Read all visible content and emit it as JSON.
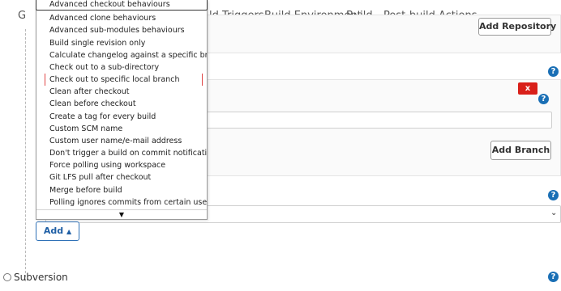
{
  "tabs": [
    {
      "label": "G"
    },
    {
      "label": "ld Triggers"
    },
    {
      "label": "Build Environment"
    },
    {
      "label": "Build"
    },
    {
      "label": "Post-build Actions"
    }
  ],
  "buttons": {
    "add_repository": "Add Repository",
    "add_branch": "Add Branch",
    "add": "Add",
    "delete_x": "x"
  },
  "help_glyph": "?",
  "dropdown": {
    "items": [
      "Advanced checkout behaviours",
      "Advanced clone behaviours",
      "Advanced sub-modules behaviours",
      "Build single revision only",
      "Calculate changelog against a specific branch",
      "Check out to a sub-directory",
      "Check out to specific local branch",
      "Clean after checkout",
      "Clean before checkout",
      "Create a tag for every build",
      "Custom SCM name",
      "Custom user name/e-mail address",
      "Don't trigger a build on commit notifications",
      "Force polling using workspace",
      "Git LFS pull after checkout",
      "Merge before build",
      "Polling ignores commits from certain users"
    ],
    "highlighted_index": 6,
    "more_arrow": "▼"
  },
  "scm_options": {
    "subversion_label": "Subversion"
  },
  "colors": {
    "accent_blue": "#1a6fb5",
    "delete_red": "#d9201a",
    "highlight_red": "#e04646"
  }
}
